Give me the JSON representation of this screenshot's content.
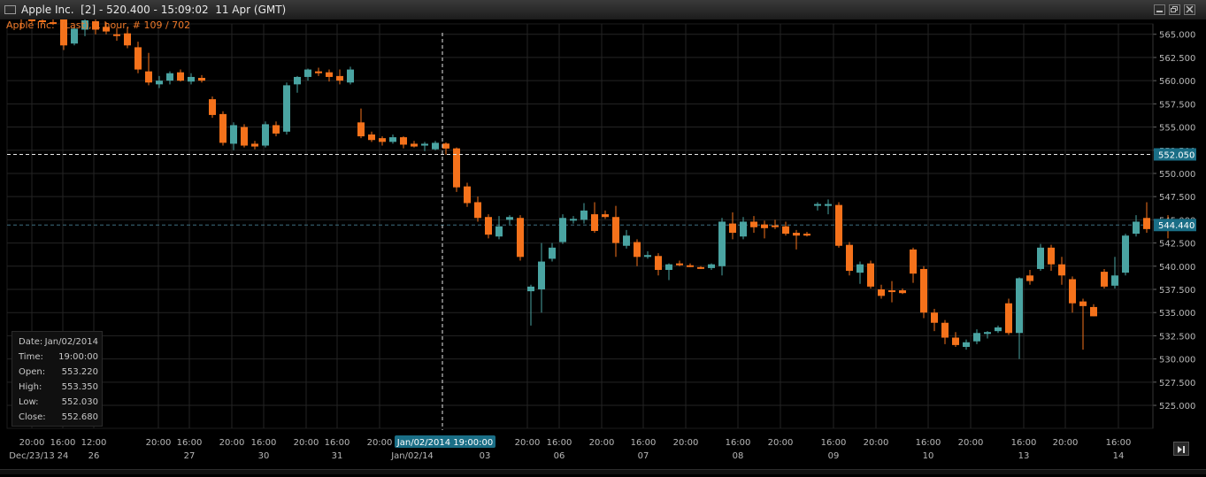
{
  "window": {
    "title": "Apple Inc.  [2] - 520.400 - 15:09:02  11 Apr (GMT)"
  },
  "chart_header": {
    "subtitle": "Apple Inc.  (Last), 1 hour, # 109 / 702"
  },
  "y_axis": {
    "ticks": [
      "565.000",
      "562.500",
      "560.000",
      "557.500",
      "555.000",
      "552.500",
      "550.000",
      "547.500",
      "545.000",
      "542.500",
      "540.000",
      "537.500",
      "535.000",
      "532.500",
      "530.000",
      "527.500",
      "525.000"
    ],
    "crosshair_label": "552.050",
    "last_price_label": "544.440"
  },
  "x_axis": {
    "time_labels": [
      "20:00",
      "16:00",
      "12:00",
      "20:00",
      "16:00",
      "20:00",
      "16:00",
      "20:00",
      "16:00",
      "20:00",
      "16:00",
      "20:00",
      "16:00",
      "20:00",
      "16:00",
      "20:00",
      "16:00",
      "20:00",
      "16:00",
      "20:00",
      "16:00",
      "20:00",
      "16:00",
      "20:00",
      "16:00",
      "20:00",
      "16:00"
    ],
    "date_labels": [
      "Dec/23/13",
      "24",
      "26",
      "27",
      "30",
      "31",
      "Jan/02/14",
      "03",
      "06",
      "07",
      "08",
      "09",
      "10",
      "13",
      "14"
    ],
    "crosshair_label": "Jan/02/2014 19:00:00"
  },
  "info_box": {
    "rows": [
      {
        "key": "Date:",
        "value": "Jan/02/2014"
      },
      {
        "key": "Time:",
        "value": "19:00:00"
      },
      {
        "key": "Open:",
        "value": "553.220"
      },
      {
        "key": "High:",
        "value": "553.350"
      },
      {
        "key": "Low:",
        "value": "552.030"
      },
      {
        "key": "Close:",
        "value": "552.680"
      }
    ]
  },
  "colors": {
    "up": "#4aa4a2",
    "down": "#f5721b",
    "grid": "#242424",
    "axis_text": "#b8b8b8",
    "crosshair": "#e8e8e8",
    "label_bg": "#1a6e86",
    "last_price_line": "#3e6f80"
  },
  "chart_data": {
    "type": "candlestick",
    "title": "Apple Inc.  (Last), 1 hour, # 109 / 702",
    "ylim": [
      523,
      566.5
    ],
    "y_ticks_step": 2.5,
    "crosshair": {
      "candle_index": 40,
      "price": 552.05
    },
    "last_price": 544.44,
    "candles": [
      {
        "o": 566.8,
        "h": 567.2,
        "l": 565.6,
        "c": 566.6
      },
      {
        "o": 566.6,
        "h": 566.9,
        "l": 566.2,
        "c": 566.5
      },
      {
        "o": 566.5,
        "h": 566.8,
        "l": 566.2,
        "c": 566.4
      },
      {
        "o": 566.3,
        "h": 566.6,
        "l": 566.0,
        "c": 566.2
      },
      {
        "o": 566.8,
        "h": 567.0,
        "l": 563.3,
        "c": 563.8
      },
      {
        "o": 564.0,
        "h": 565.8,
        "l": 563.8,
        "c": 565.6
      },
      {
        "o": 565.5,
        "h": 566.8,
        "l": 564.8,
        "c": 566.5
      },
      {
        "o": 566.4,
        "h": 566.7,
        "l": 565.0,
        "c": 565.5
      },
      {
        "o": 565.8,
        "h": 566.3,
        "l": 565.0,
        "c": 565.3
      },
      {
        "o": 565.0,
        "h": 565.7,
        "l": 564.3,
        "c": 564.9
      },
      {
        "o": 565.1,
        "h": 565.8,
        "l": 563.5,
        "c": 563.8
      },
      {
        "o": 563.6,
        "h": 564.2,
        "l": 560.8,
        "c": 561.2
      },
      {
        "o": 561.0,
        "h": 563.0,
        "l": 559.5,
        "c": 559.8
      },
      {
        "o": 559.6,
        "h": 560.5,
        "l": 559.2,
        "c": 560.0
      },
      {
        "o": 560.0,
        "h": 561.0,
        "l": 559.6,
        "c": 560.8
      },
      {
        "o": 560.9,
        "h": 561.2,
        "l": 559.9,
        "c": 560.0
      },
      {
        "o": 559.9,
        "h": 560.8,
        "l": 559.6,
        "c": 560.4
      },
      {
        "o": 560.3,
        "h": 560.6,
        "l": 559.8,
        "c": 560.0
      },
      {
        "o": 558.0,
        "h": 558.3,
        "l": 556.0,
        "c": 556.3
      },
      {
        "o": 556.4,
        "h": 556.7,
        "l": 553.0,
        "c": 553.3
      },
      {
        "o": 553.2,
        "h": 555.5,
        "l": 552.5,
        "c": 555.2
      },
      {
        "o": 555.0,
        "h": 555.3,
        "l": 552.8,
        "c": 553.0
      },
      {
        "o": 553.2,
        "h": 553.5,
        "l": 552.6,
        "c": 552.9
      },
      {
        "o": 553.0,
        "h": 555.6,
        "l": 552.8,
        "c": 555.3
      },
      {
        "o": 555.2,
        "h": 555.6,
        "l": 554.0,
        "c": 554.3
      },
      {
        "o": 554.5,
        "h": 559.8,
        "l": 554.2,
        "c": 559.5
      },
      {
        "o": 559.6,
        "h": 560.5,
        "l": 558.7,
        "c": 560.4
      },
      {
        "o": 560.4,
        "h": 561.3,
        "l": 560.0,
        "c": 561.2
      },
      {
        "o": 561.0,
        "h": 561.4,
        "l": 560.5,
        "c": 560.8
      },
      {
        "o": 560.9,
        "h": 561.2,
        "l": 559.9,
        "c": 560.4
      },
      {
        "o": 560.5,
        "h": 561.2,
        "l": 559.6,
        "c": 560.0
      },
      {
        "o": 559.8,
        "h": 561.5,
        "l": 559.6,
        "c": 561.2
      },
      {
        "o": 555.5,
        "h": 557.0,
        "l": 553.8,
        "c": 554.0
      },
      {
        "o": 554.2,
        "h": 554.5,
        "l": 553.4,
        "c": 553.6
      },
      {
        "o": 553.8,
        "h": 554.0,
        "l": 553.0,
        "c": 553.4
      },
      {
        "o": 553.4,
        "h": 554.2,
        "l": 553.2,
        "c": 553.9
      },
      {
        "o": 553.9,
        "h": 554.0,
        "l": 552.7,
        "c": 553.1
      },
      {
        "o": 553.2,
        "h": 553.5,
        "l": 552.8,
        "c": 552.9
      },
      {
        "o": 553.0,
        "h": 553.4,
        "l": 552.4,
        "c": 553.2
      },
      {
        "o": 552.6,
        "h": 553.5,
        "l": 552.5,
        "c": 553.3
      },
      {
        "o": 553.22,
        "h": 553.35,
        "l": 552.03,
        "c": 552.68
      },
      {
        "o": 552.7,
        "h": 552.8,
        "l": 548.0,
        "c": 548.5
      },
      {
        "o": 548.6,
        "h": 549.0,
        "l": 546.4,
        "c": 546.8
      },
      {
        "o": 546.9,
        "h": 547.5,
        "l": 544.8,
        "c": 545.2
      },
      {
        "o": 545.3,
        "h": 545.6,
        "l": 543.0,
        "c": 543.4
      },
      {
        "o": 543.2,
        "h": 545.4,
        "l": 542.9,
        "c": 544.3
      },
      {
        "o": 545.0,
        "h": 545.5,
        "l": 544.5,
        "c": 545.3
      },
      {
        "o": 545.2,
        "h": 545.5,
        "l": 540.6,
        "c": 541.0
      },
      {
        "o": 537.3,
        "h": 538.0,
        "l": 533.6,
        "c": 537.8
      },
      {
        "o": 537.5,
        "h": 542.5,
        "l": 535.0,
        "c": 540.5
      },
      {
        "o": 540.8,
        "h": 542.5,
        "l": 540.5,
        "c": 542.0
      },
      {
        "o": 542.6,
        "h": 545.6,
        "l": 542.4,
        "c": 545.2
      },
      {
        "o": 545.0,
        "h": 545.4,
        "l": 544.6,
        "c": 545.1
      },
      {
        "o": 545.0,
        "h": 546.8,
        "l": 544.6,
        "c": 546.0
      },
      {
        "o": 545.6,
        "h": 546.9,
        "l": 543.6,
        "c": 543.8
      },
      {
        "o": 545.6,
        "h": 546.0,
        "l": 545.1,
        "c": 545.3
      },
      {
        "o": 545.3,
        "h": 546.5,
        "l": 541.0,
        "c": 542.5
      },
      {
        "o": 542.2,
        "h": 543.9,
        "l": 541.9,
        "c": 543.3
      },
      {
        "o": 542.6,
        "h": 542.9,
        "l": 540.0,
        "c": 541.0
      },
      {
        "o": 541.0,
        "h": 541.6,
        "l": 540.8,
        "c": 541.2
      },
      {
        "o": 541.1,
        "h": 541.4,
        "l": 539.0,
        "c": 539.6
      },
      {
        "o": 539.6,
        "h": 540.3,
        "l": 538.5,
        "c": 540.2
      },
      {
        "o": 540.3,
        "h": 540.6,
        "l": 540.0,
        "c": 540.1
      },
      {
        "o": 540.1,
        "h": 540.3,
        "l": 539.9,
        "c": 540.0
      },
      {
        "o": 539.9,
        "h": 540.0,
        "l": 539.7,
        "c": 539.8
      },
      {
        "o": 539.8,
        "h": 540.3,
        "l": 539.6,
        "c": 540.2
      },
      {
        "o": 540.0,
        "h": 545.2,
        "l": 539.0,
        "c": 544.8
      },
      {
        "o": 544.6,
        "h": 545.8,
        "l": 542.9,
        "c": 543.6
      },
      {
        "o": 543.2,
        "h": 545.3,
        "l": 542.9,
        "c": 544.8
      },
      {
        "o": 544.8,
        "h": 545.4,
        "l": 543.6,
        "c": 544.2
      },
      {
        "o": 544.5,
        "h": 544.9,
        "l": 543.0,
        "c": 544.1
      },
      {
        "o": 544.4,
        "h": 545.0,
        "l": 544.0,
        "c": 544.3
      },
      {
        "o": 544.3,
        "h": 544.8,
        "l": 543.3,
        "c": 543.5
      },
      {
        "o": 543.6,
        "h": 543.9,
        "l": 541.8,
        "c": 543.3
      },
      {
        "o": 543.5,
        "h": 543.7,
        "l": 543.2,
        "c": 543.3
      },
      {
        "o": 546.6,
        "h": 546.9,
        "l": 546.0,
        "c": 546.7
      },
      {
        "o": 546.5,
        "h": 547.2,
        "l": 545.6,
        "c": 546.7
      },
      {
        "o": 546.6,
        "h": 546.9,
        "l": 542.0,
        "c": 542.2
      },
      {
        "o": 542.3,
        "h": 542.6,
        "l": 539.0,
        "c": 539.5
      },
      {
        "o": 539.3,
        "h": 540.5,
        "l": 538.1,
        "c": 540.2
      },
      {
        "o": 540.3,
        "h": 540.6,
        "l": 537.6,
        "c": 537.8
      },
      {
        "o": 537.5,
        "h": 538.0,
        "l": 536.5,
        "c": 536.8
      },
      {
        "o": 537.4,
        "h": 538.4,
        "l": 536.1,
        "c": 537.3
      },
      {
        "o": 537.4,
        "h": 537.6,
        "l": 537.0,
        "c": 537.1
      },
      {
        "o": 541.8,
        "h": 542.0,
        "l": 538.2,
        "c": 539.2
      },
      {
        "o": 539.7,
        "h": 540.0,
        "l": 534.4,
        "c": 535.0
      },
      {
        "o": 535.0,
        "h": 535.4,
        "l": 533.0,
        "c": 533.9
      },
      {
        "o": 533.9,
        "h": 534.2,
        "l": 531.6,
        "c": 532.3
      },
      {
        "o": 532.3,
        "h": 532.9,
        "l": 531.3,
        "c": 531.5
      },
      {
        "o": 531.3,
        "h": 532.1,
        "l": 531.0,
        "c": 531.8
      },
      {
        "o": 531.9,
        "h": 533.2,
        "l": 531.6,
        "c": 532.8
      },
      {
        "o": 532.7,
        "h": 533.0,
        "l": 532.2,
        "c": 532.9
      },
      {
        "o": 533.0,
        "h": 533.6,
        "l": 532.8,
        "c": 533.4
      },
      {
        "o": 536.0,
        "h": 536.5,
        "l": 532.6,
        "c": 532.8
      },
      {
        "o": 532.8,
        "h": 538.8,
        "l": 530.0,
        "c": 538.7
      },
      {
        "o": 539.0,
        "h": 539.6,
        "l": 538.0,
        "c": 538.4
      },
      {
        "o": 539.7,
        "h": 542.4,
        "l": 539.5,
        "c": 542.0
      },
      {
        "o": 542.0,
        "h": 542.3,
        "l": 539.5,
        "c": 540.2
      },
      {
        "o": 540.2,
        "h": 541.0,
        "l": 538.0,
        "c": 539.0
      },
      {
        "o": 538.6,
        "h": 538.9,
        "l": 535.0,
        "c": 536.0
      },
      {
        "o": 536.2,
        "h": 536.5,
        "l": 531.0,
        "c": 535.7
      },
      {
        "o": 535.6,
        "h": 535.9,
        "l": 534.6,
        "c": 534.6
      },
      {
        "o": 539.4,
        "h": 539.7,
        "l": 537.6,
        "c": 537.8
      },
      {
        "o": 537.9,
        "h": 541.0,
        "l": 537.6,
        "c": 539.0
      },
      {
        "o": 539.3,
        "h": 543.5,
        "l": 539.0,
        "c": 543.3
      },
      {
        "o": 543.5,
        "h": 545.5,
        "l": 543.2,
        "c": 544.8
      },
      {
        "o": 545.2,
        "h": 546.9,
        "l": 543.6,
        "c": 544.0
      },
      {
        "o": 544.2,
        "h": 544.6,
        "l": 543.8,
        "c": 544.4
      },
      {
        "o": 544.5,
        "h": 545.5,
        "l": 543.0,
        "c": 544.4
      }
    ]
  }
}
